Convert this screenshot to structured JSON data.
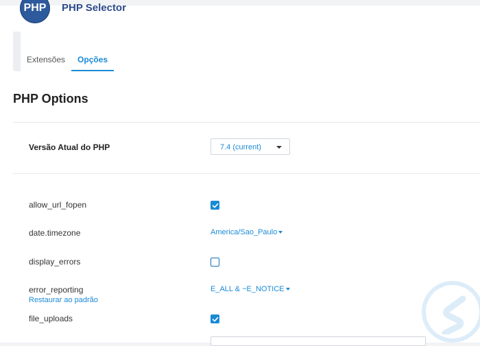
{
  "header": {
    "logo_text": "PHP",
    "title": "PHP Selector"
  },
  "tabs": [
    {
      "label": "Extensões",
      "active": false
    },
    {
      "label": "Opções",
      "active": true
    }
  ],
  "section": {
    "title": "PHP Options"
  },
  "version": {
    "label": "Versão Atual do PHP",
    "selected": "7.4 (current)"
  },
  "options": {
    "allow_url_fopen": {
      "label": "allow_url_fopen",
      "checked": true
    },
    "date_timezone": {
      "label": "date.timezone",
      "value": "America/Sao_Paulo"
    },
    "display_errors": {
      "label": "display_errors",
      "checked": false
    },
    "error_reporting": {
      "label": "error_reporting",
      "value": "E_ALL & ~E_NOTICE",
      "reset_label": "Restaurar ao padrão"
    },
    "file_uploads": {
      "label": "file_uploads",
      "checked": true
    }
  },
  "colors": {
    "accent": "#1a8ad6",
    "title": "#2b4a8b",
    "logo": "#2d5a9c"
  },
  "icons": {
    "logo": "php-logo-icon",
    "check": "check-icon",
    "caret": "chevron-down-icon",
    "watermark": "watermark-logo-icon"
  }
}
